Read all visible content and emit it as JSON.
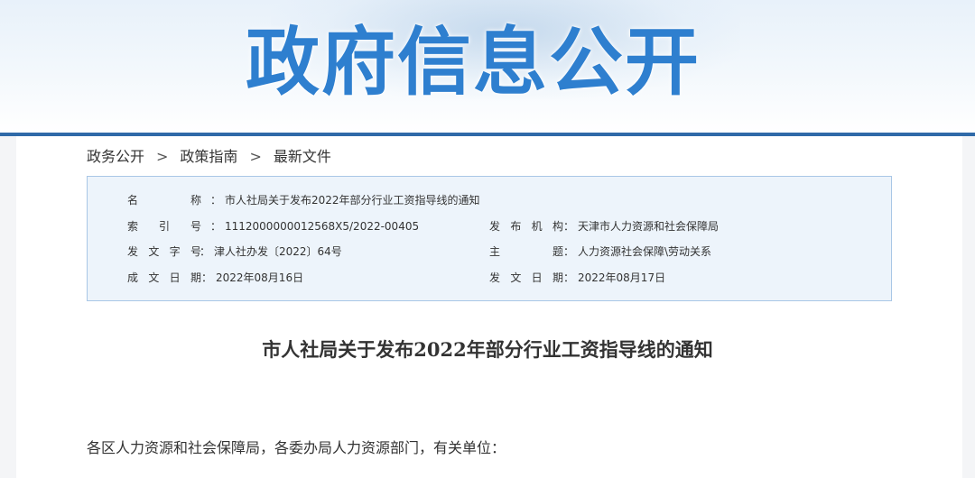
{
  "banner": {
    "title": "政府信息公开"
  },
  "breadcrumb": {
    "items": [
      "政务公开",
      "政策指南",
      "最新文件"
    ],
    "separator": ">"
  },
  "info": {
    "name_label": "名 称",
    "name_value": "市人社局关于发布2022年部分行业工资指导线的通知",
    "index_label": "索 引 号",
    "index_value": "1112000000012568X5/2022-00405",
    "publisher_label": "发 布 机 构",
    "publisher_value": "天津市人力资源和社会保障局",
    "docno_label": "发 文 字 号",
    "docno_value": "津人社办发〔2022〕64号",
    "topic_label": "主 题",
    "topic_value": "人力资源社会保障\\劳动关系",
    "created_label": "成 文 日 期",
    "created_value": "2022年08月16日",
    "issued_label": "发 文 日 期",
    "issued_value": "2022年08月17日",
    "colon": "："
  },
  "document": {
    "title": "市人社局关于发布2022年部分行业工资指导线的通知",
    "salutation": "各区人力资源和社会保障局，各委办局人力资源部门，有关单位："
  }
}
